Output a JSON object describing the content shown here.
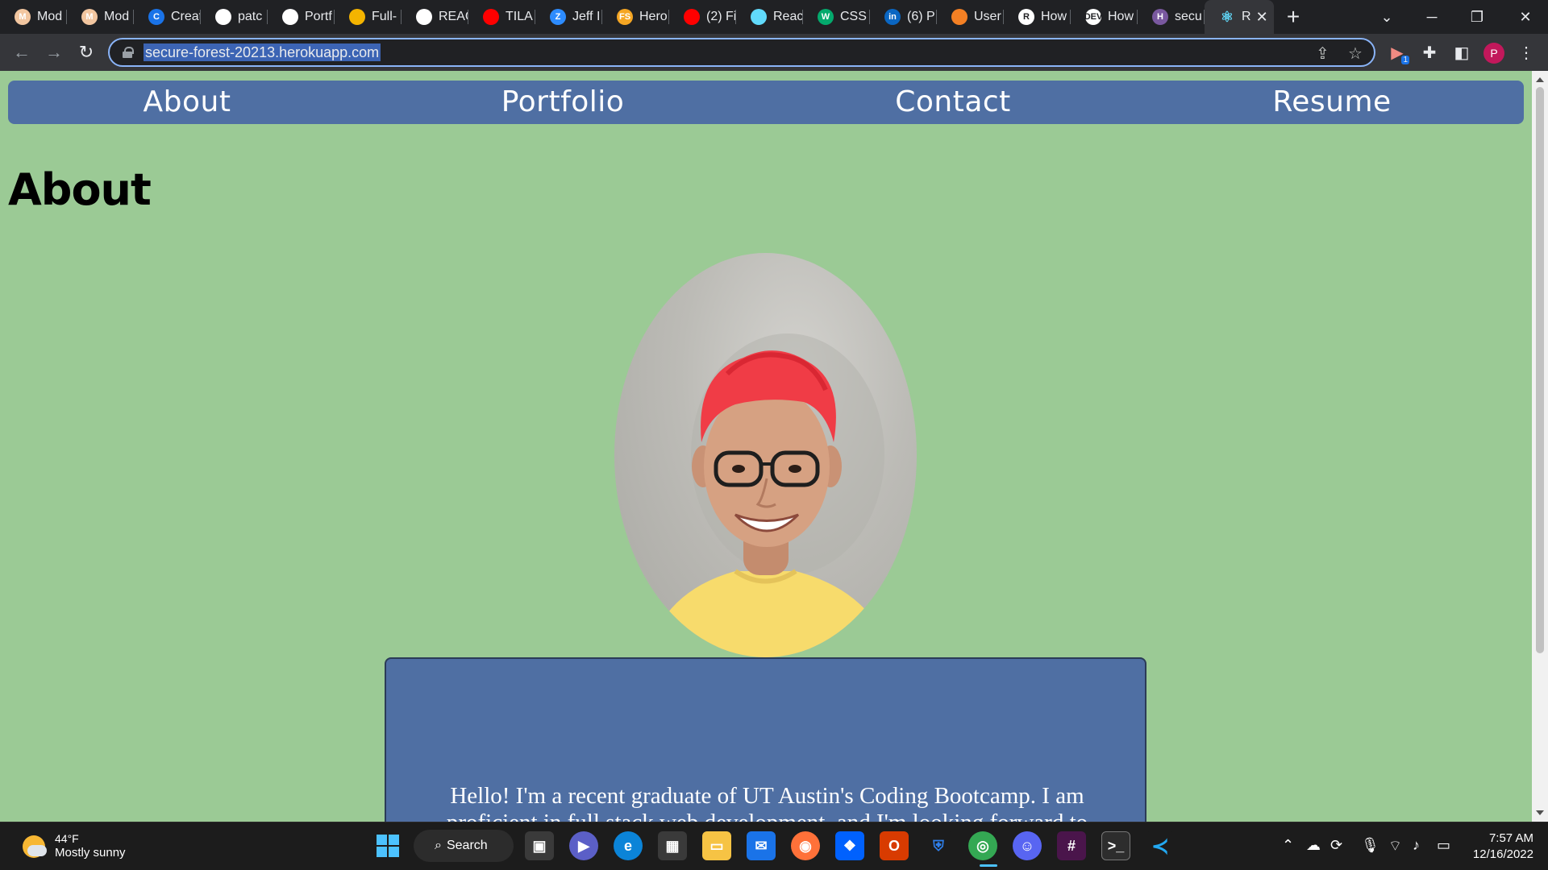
{
  "browser": {
    "tabs": [
      {
        "label": "Mod",
        "fav": "M",
        "color": "#f2c6a0",
        "icon": "globe-icon"
      },
      {
        "label": "Mod",
        "fav": "M",
        "color": "#f2c6a0",
        "icon": "globe-icon"
      },
      {
        "label": "Creat",
        "fav": "C",
        "color": "#1a73e8",
        "icon": "create-icon"
      },
      {
        "label": "patc",
        "fav": "",
        "color": "#ffffff",
        "icon": "github-icon"
      },
      {
        "label": "Portf",
        "fav": "",
        "color": "#ffffff",
        "icon": "github-icon"
      },
      {
        "label": "Full-",
        "fav": "",
        "color": "#f4b400",
        "icon": "slides-icon"
      },
      {
        "label": "REAC",
        "fav": "",
        "color": "#ffffff",
        "icon": "github-icon"
      },
      {
        "label": "TILA",
        "fav": "",
        "color": "#ff0000",
        "icon": "youtube-icon"
      },
      {
        "label": "Jeff I",
        "fav": "Z",
        "color": "#2d8cff",
        "icon": "zoom-icon"
      },
      {
        "label": "Hero",
        "fav": "FS",
        "color": "#f5a623",
        "icon": "fs-icon"
      },
      {
        "label": "(2) Fi",
        "fav": "",
        "color": "#ff0000",
        "icon": "youtube-icon"
      },
      {
        "label": "Reac",
        "fav": "",
        "color": "#61dafb",
        "icon": "react-icon"
      },
      {
        "label": "CSS",
        "fav": "W",
        "color": "#04aa6d",
        "icon": "w3schools-icon"
      },
      {
        "label": "(6) P",
        "fav": "in",
        "color": "#0a66c2",
        "icon": "linkedin-icon"
      },
      {
        "label": "User",
        "fav": "",
        "color": "#f48024",
        "icon": "stackoverflow-icon"
      },
      {
        "label": "How",
        "fav": "R",
        "color": "#ffffff",
        "icon": "r-icon"
      },
      {
        "label": "How",
        "fav": "DEV",
        "color": "#ffffff",
        "icon": "dev-icon"
      },
      {
        "label": "secu",
        "fav": "H",
        "color": "#79589f",
        "icon": "heroku-icon"
      }
    ],
    "active_tab": {
      "label": "R",
      "icon": "react-icon"
    },
    "new_tab": "+",
    "url": "secure-forest-20213.herokuapp.com",
    "profile_initial": "P",
    "extension_badge": "1"
  },
  "site": {
    "nav": [
      "About",
      "Portfolio",
      "Contact",
      "Resume"
    ],
    "title": "About",
    "about_text": "Hello! I'm a recent graduate of UT Austin's Coding Bootcamp. I am proficient in full stack web development, and I'm looking forward to"
  },
  "taskbar": {
    "temp": "44°F",
    "weather": "Mostly sunny",
    "search": "Search",
    "time": "7:57 AM",
    "date": "12/16/2022"
  },
  "colors": {
    "page_bg": "#9bca95",
    "nav_bg": "#4f6fa3",
    "card_bg": "#4f6fa3",
    "hair": "#f03c46",
    "shirt": "#f9dc6e"
  }
}
